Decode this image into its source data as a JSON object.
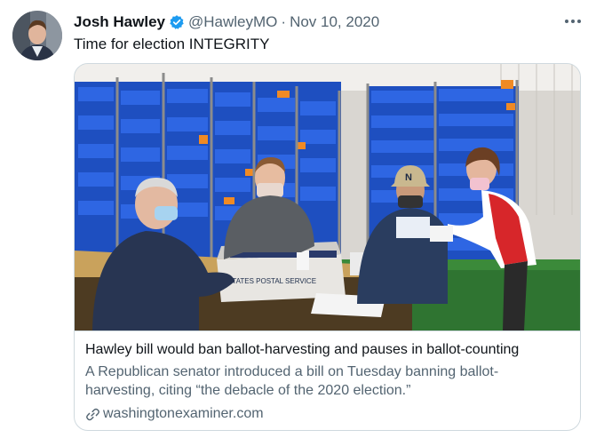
{
  "tweet": {
    "author_name": "Josh Hawley",
    "author_handle": "@HawleyMO",
    "separator": "·",
    "date": "Nov 10, 2020",
    "text": "Time for election INTEGRITY",
    "verified_icon": "verified-badge-icon",
    "more_icon": "more-options-icon"
  },
  "card": {
    "image_text_box": "STATES POSTAL SERVICE",
    "image_text_cap": "N",
    "title": "Hawley bill would ban ballot-harvesting and pauses in ballot-counting",
    "description": "A Republican senator introduced a bill on Tuesday banning ballot-harvesting, citing “the debacle of the 2020 election.”",
    "link_icon": "link-icon",
    "domain": "washingtonexaminer.com"
  },
  "colors": {
    "text_primary": "#0f1419",
    "text_secondary": "#536471",
    "verified_blue": "#1d9bf0",
    "border": "#cfd9de",
    "tray_blue": "#1f55c9"
  }
}
